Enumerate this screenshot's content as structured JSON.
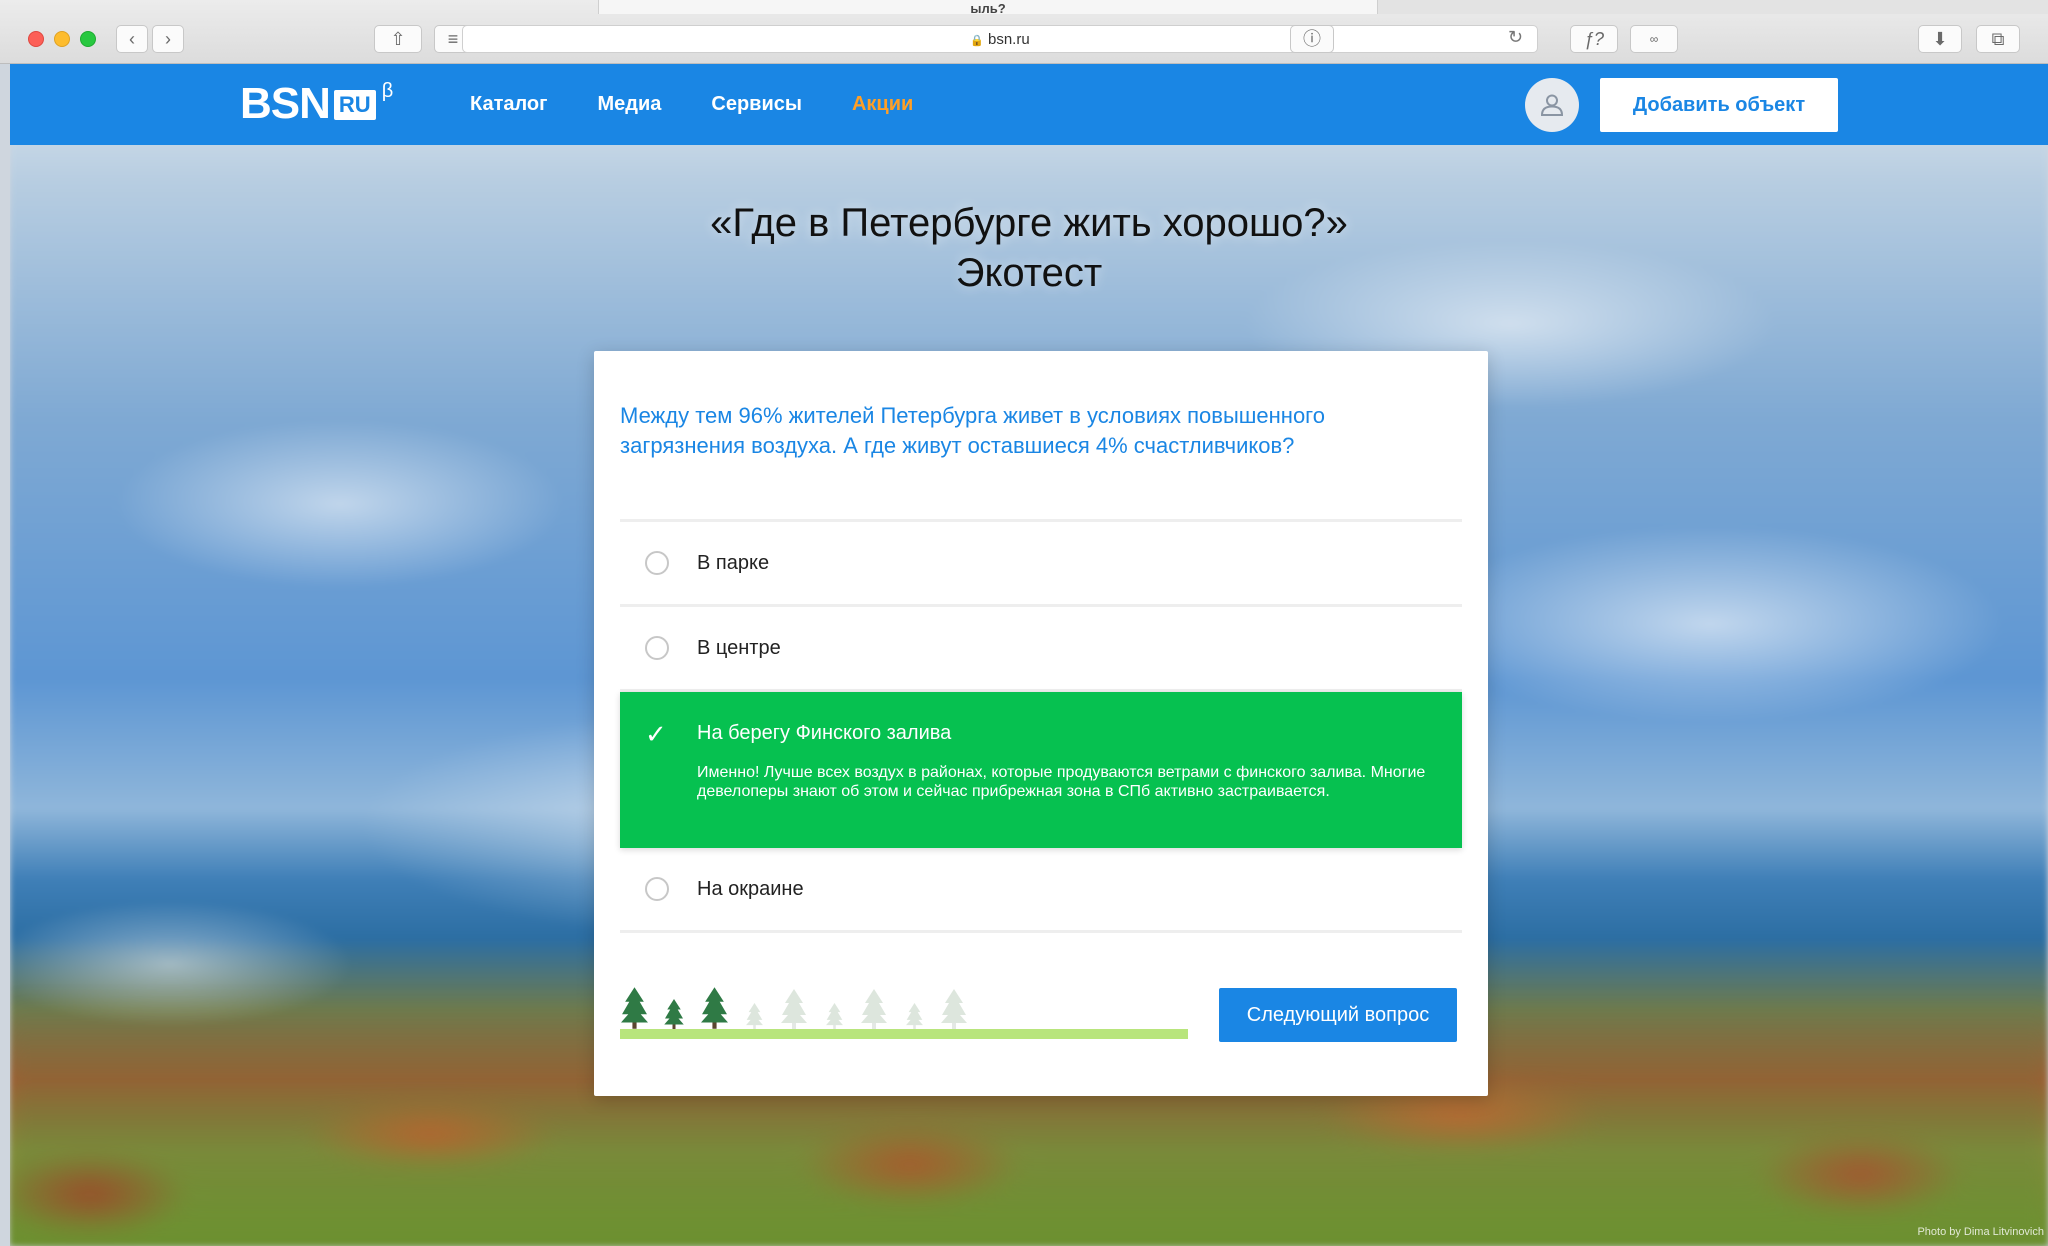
{
  "browser": {
    "url": "bsn.ru",
    "tab_fragment": "ыль?"
  },
  "site": {
    "logo_text": "BSN",
    "logo_badge": "RU",
    "logo_beta": "β",
    "nav": [
      "Каталог",
      "Медиа",
      "Сервисы",
      "Акции"
    ],
    "add_button": "Добавить объект"
  },
  "title": {
    "line1": "«Где в Петербурге жить хорошо?»",
    "line2": "Экотест"
  },
  "quiz": {
    "question": "Между тем 96% жителей Петербурга живет в условиях повышенного загрязнения воздуха. А где живут оставшиеся 4% счастливчиков?",
    "answers": [
      {
        "label": "В парке",
        "state": "unselected"
      },
      {
        "label": "В центре",
        "state": "unselected"
      },
      {
        "label": "На берегу Финского залива",
        "state": "correct",
        "explanation": "Именно! Лучше всех воздух в районах, которые продуваются ветрами с финского залива. Многие девелоперы знают об этом и сейчас прибрежная зона в СПб активно застраивается."
      },
      {
        "label": "На окраине",
        "state": "unselected"
      }
    ],
    "progress": {
      "completed": 3,
      "total": 9
    },
    "next_button": "Следующий вопрос"
  },
  "photo_credit": "Photo by Dima Litvinovich",
  "colors": {
    "brand": "#1a86e4",
    "accent": "#ff9f25",
    "correct": "#06c150",
    "ground": "#b8e57c"
  }
}
